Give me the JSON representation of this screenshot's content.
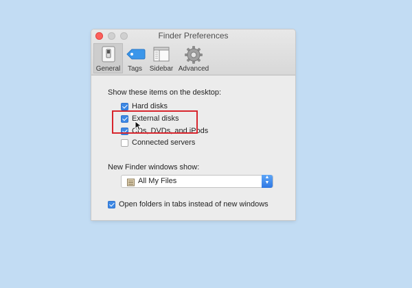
{
  "window": {
    "title": "Finder Preferences"
  },
  "tabs": [
    {
      "label": "General",
      "icon": "general-switch-icon",
      "selected": true
    },
    {
      "label": "Tags",
      "icon": "tag-icon",
      "selected": false
    },
    {
      "label": "Sidebar",
      "icon": "sidebar-icon",
      "selected": false
    },
    {
      "label": "Advanced",
      "icon": "gear-icon",
      "selected": false
    }
  ],
  "desktop_section": {
    "heading": "Show these items on the desktop:",
    "items": [
      {
        "label": "Hard disks",
        "checked": true
      },
      {
        "label": "External disks",
        "checked": true
      },
      {
        "label": "CDs, DVDs, and iPods",
        "checked": true
      },
      {
        "label": "Connected servers",
        "checked": false
      }
    ]
  },
  "new_window": {
    "heading": "New Finder windows show:",
    "selected_value": "All My Files",
    "icon": "all-my-files-icon"
  },
  "tabs_option": {
    "label": "Open folders in tabs instead of new windows",
    "checked": true
  },
  "colors": {
    "checkbox_accent": "#3d88e4",
    "highlight_box": "#d7232b",
    "desktop_background": "#c2dcf3"
  }
}
